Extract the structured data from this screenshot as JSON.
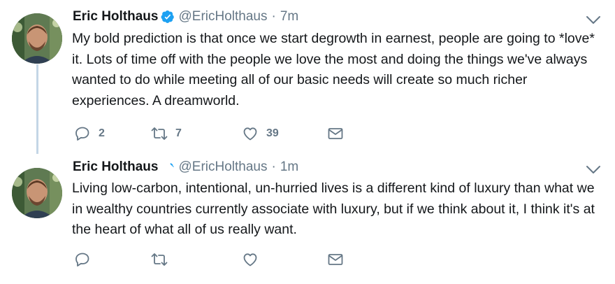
{
  "tweets": [
    {
      "name": "Eric Holthaus",
      "handle": "@EricHolthaus",
      "separator": "·",
      "time": "7m",
      "text": "My bold prediction is that once we start degrowth in earnest, people are going to *love* it. Lots of time off with the people we love the most and doing the things we've always wanted to do while meeting all of our basic needs will create so much richer experiences. A dreamworld.",
      "replies": "2",
      "retweets": "7",
      "likes": "39"
    },
    {
      "name": "Eric Holthaus",
      "handle": "@EricHolthaus",
      "separator": "·",
      "time": "1m",
      "text": "Living low-carbon, intentional, un-hurried lives is a different kind of luxury than what we in wealthy countries currently associate with luxury, but if we think about it, I think it's at the heart of what all of us really want.",
      "replies": "",
      "retweets": "",
      "likes": ""
    }
  ],
  "icons": {
    "verified": "verified-badge-icon",
    "caret": "chevron-down-icon",
    "reply": "reply-icon",
    "retweet": "retweet-icon",
    "like": "heart-icon",
    "dm": "envelope-icon"
  },
  "colors": {
    "text": "#14171a",
    "secondary": "#657786",
    "verified": "#1da1f2",
    "thread_line": "#c4d6e6"
  }
}
